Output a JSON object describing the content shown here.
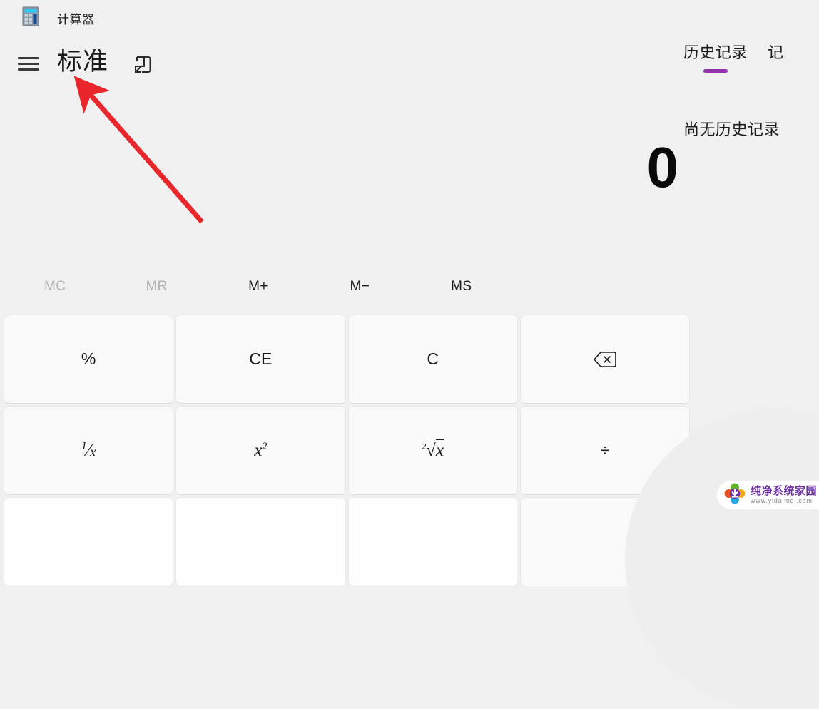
{
  "window": {
    "app_title": "计算器",
    "app_icon": "calculator-icon"
  },
  "header": {
    "menu_icon": "hamburger-menu-icon",
    "mode_label": "标准",
    "keep_on_top_icon": "keep-on-top-icon"
  },
  "history": {
    "tabs": [
      {
        "label": "历史记录",
        "selected": true
      },
      {
        "label": "记",
        "selected": false
      }
    ],
    "accent_color": "#9134ab",
    "empty_message": "尚无历史记录"
  },
  "display": {
    "value": "0"
  },
  "memory": {
    "buttons": [
      {
        "label": "MC",
        "enabled": false
      },
      {
        "label": "MR",
        "enabled": false
      },
      {
        "label": "M+",
        "enabled": true
      },
      {
        "label": "M−",
        "enabled": true
      },
      {
        "label": "MS",
        "enabled": true
      }
    ]
  },
  "keypad": {
    "rows": [
      [
        {
          "label": "%",
          "name": "percent-button",
          "type": "fn"
        },
        {
          "label": "CE",
          "name": "clear-entry-button",
          "type": "fn"
        },
        {
          "label": "C",
          "name": "clear-button",
          "type": "fn"
        },
        {
          "label": "",
          "name": "backspace-button",
          "type": "icon",
          "icon": "backspace-icon"
        }
      ],
      [
        {
          "label": "1/x",
          "name": "reciprocal-button",
          "type": "fn"
        },
        {
          "label": "x²",
          "name": "square-button",
          "type": "fn"
        },
        {
          "label": "²√x",
          "name": "square-root-button",
          "type": "fn"
        },
        {
          "label": "÷",
          "name": "divide-button",
          "type": "fn"
        }
      ],
      [
        {
          "label": "",
          "name": "seven-button",
          "type": "num"
        },
        {
          "label": "",
          "name": "eight-button",
          "type": "num"
        },
        {
          "label": "",
          "name": "nine-button",
          "type": "num"
        },
        {
          "label": "",
          "name": "multiply-button",
          "type": "fn"
        }
      ]
    ]
  },
  "annotation": {
    "arrow_color": "#e8262b",
    "arrow_from": "282,310",
    "arrow_to": "108,112"
  },
  "watermark": {
    "title": "纯净系统家园",
    "url": "www.yidaimei.com",
    "title_color": "#6a2fa0",
    "icon": "download-flower-icon"
  }
}
